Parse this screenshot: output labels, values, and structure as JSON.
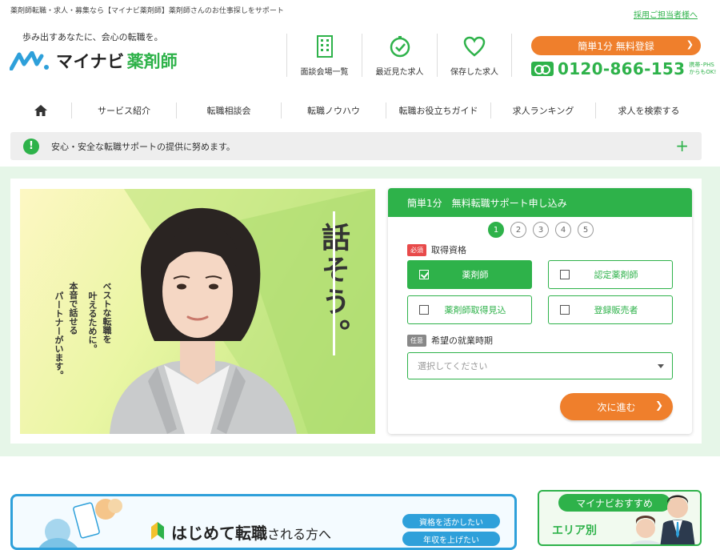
{
  "header": {
    "tagline": "薬剤師転職・求人・募集なら【マイナビ薬剤師】薬剤師さんのお仕事探しをサポート",
    "recruiter_link": "採用ご担当者様へ",
    "catchphrase": "歩み出すあなたに、会心の転職を。",
    "logo_main": "マイナビ",
    "logo_sub": "薬剤師",
    "icons": [
      {
        "label": "面談会場一覧",
        "icon": "building-icon"
      },
      {
        "label": "最近見た求人",
        "icon": "clock-icon"
      },
      {
        "label": "保存した求人",
        "icon": "heart-icon"
      }
    ],
    "register_label": "簡単1分 無料登録",
    "phone": "0120-866-153",
    "phone_note_1": "携帯･PHS",
    "phone_note_2": "からもOK!"
  },
  "nav": {
    "items": [
      "サービス紹介",
      "転職相談会",
      "転職ノウハウ",
      "転職お役立ちガイド",
      "求人ランキング",
      "求人を検索する"
    ]
  },
  "notice": {
    "text": "安心・安全な転職サポートの提供に努めます。"
  },
  "banner": {
    "headline": "話そう。",
    "copy_lines": [
      "ベストな転職を",
      "叶えるために。",
      "本音で話せる",
      "パートナーがいます。"
    ]
  },
  "form": {
    "title": "簡単1分　無料転職サポート申し込み",
    "steps": [
      "1",
      "2",
      "3",
      "4",
      "5"
    ],
    "current_step": 1,
    "qualification_label": "取得資格",
    "required_badge": "必須",
    "options": [
      {
        "label": "薬剤師",
        "checked": true
      },
      {
        "label": "認定薬剤師",
        "checked": false
      },
      {
        "label": "薬剤師取得見込",
        "checked": false
      },
      {
        "label": "登録販売者",
        "checked": false
      }
    ],
    "timing_label": "希望の就業時期",
    "optional_badge": "任意",
    "select_placeholder": "選択してください",
    "next_label": "次に進む"
  },
  "bottom": {
    "beginner_title_1": "はじめて転職",
    "beginner_title_2": "される方へ",
    "pills": [
      "資格を活かしたい",
      "年収を上げたい"
    ],
    "reco_label": "マイナビおすすめ",
    "area_text": "エリア別"
  },
  "colors": {
    "brand_green": "#2eb24a",
    "cta_orange": "#ef7f2c",
    "blue": "#2ea0da"
  }
}
